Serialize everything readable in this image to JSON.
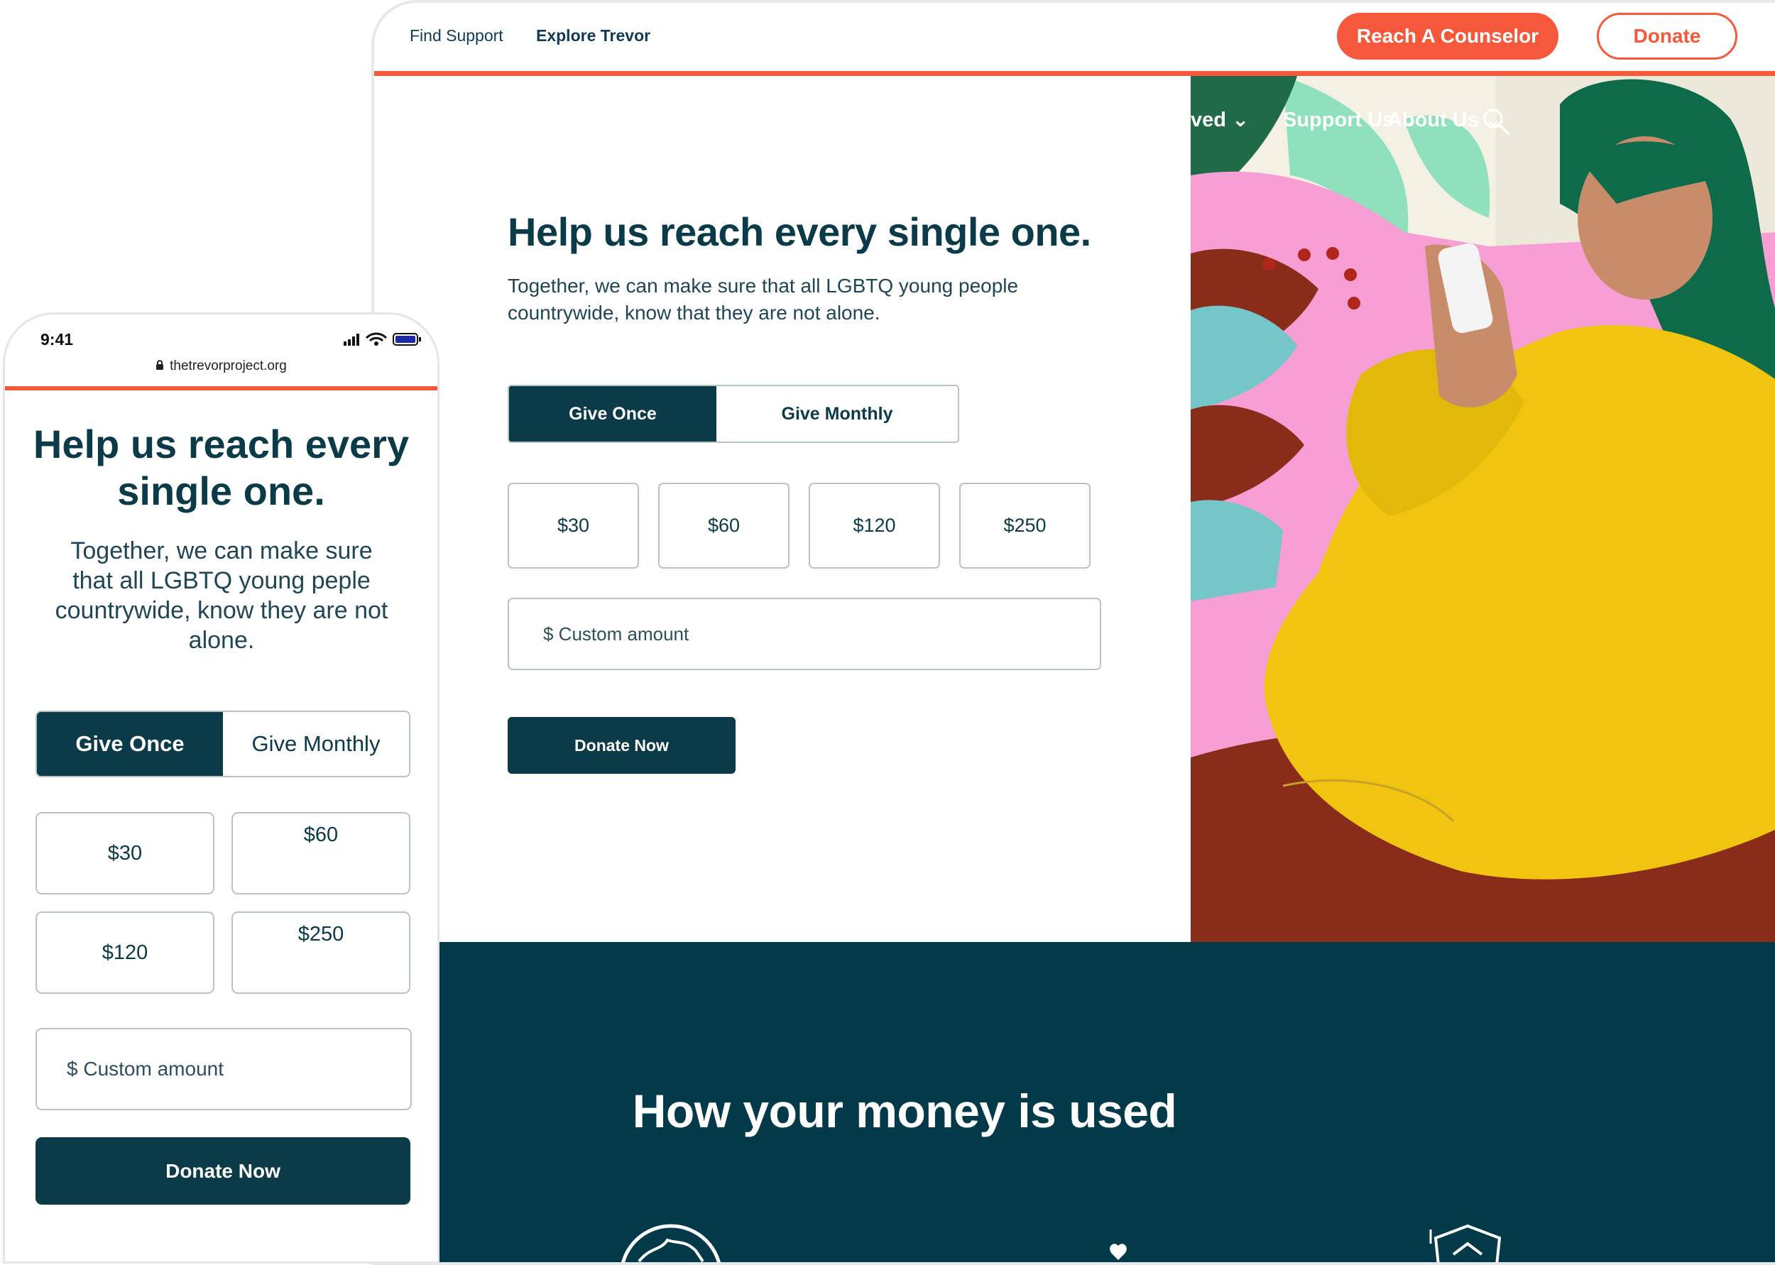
{
  "desktop": {
    "topnav": {
      "find_support": "Find Support",
      "explore_trevor": "Explore Trevor",
      "reach_counselor": "Reach A Counselor",
      "donate": "Donate"
    },
    "art_nav": {
      "get_involved_partial": "ved",
      "support_us": "Support Us",
      "about_us": "About Us"
    },
    "hero": {
      "heading": "Help us reach every single one.",
      "subtext": "Together, we can make sure that all LGBTQ young people countrywide, know that they are not alone.",
      "give_once": "Give Once",
      "give_monthly": "Give Monthly",
      "amounts": [
        "$30",
        "$60",
        "$120",
        "$250"
      ],
      "custom_placeholder": "$ Custom amount",
      "donate_now": "Donate Now"
    },
    "band": {
      "title": "How your money is used"
    }
  },
  "mobile": {
    "time": "9:41",
    "url": "thetrevorproject.org",
    "heading": "Help us reach every single one.",
    "subtext": "Together, we can make sure that all LGBTQ young peple countrywide, know they are not alone.",
    "give_once": "Give Once",
    "give_monthly": "Give Monthly",
    "amounts": [
      "$30",
      "$60",
      "$120",
      "$250"
    ],
    "custom_placeholder": "$ Custom amount",
    "donate_now": "Donate Now"
  },
  "colors": {
    "brand_orange": "#f5583a",
    "brand_dark_teal": "#0b3a48",
    "band_teal": "#033a4a",
    "field_border": "#b8c3c7"
  },
  "icons": [
    "lock-icon",
    "search-icon",
    "chevron-down-icon",
    "signal-icon",
    "wifi-icon",
    "battery-icon",
    "globe-icon",
    "hearts-icon",
    "shield-icon"
  ]
}
